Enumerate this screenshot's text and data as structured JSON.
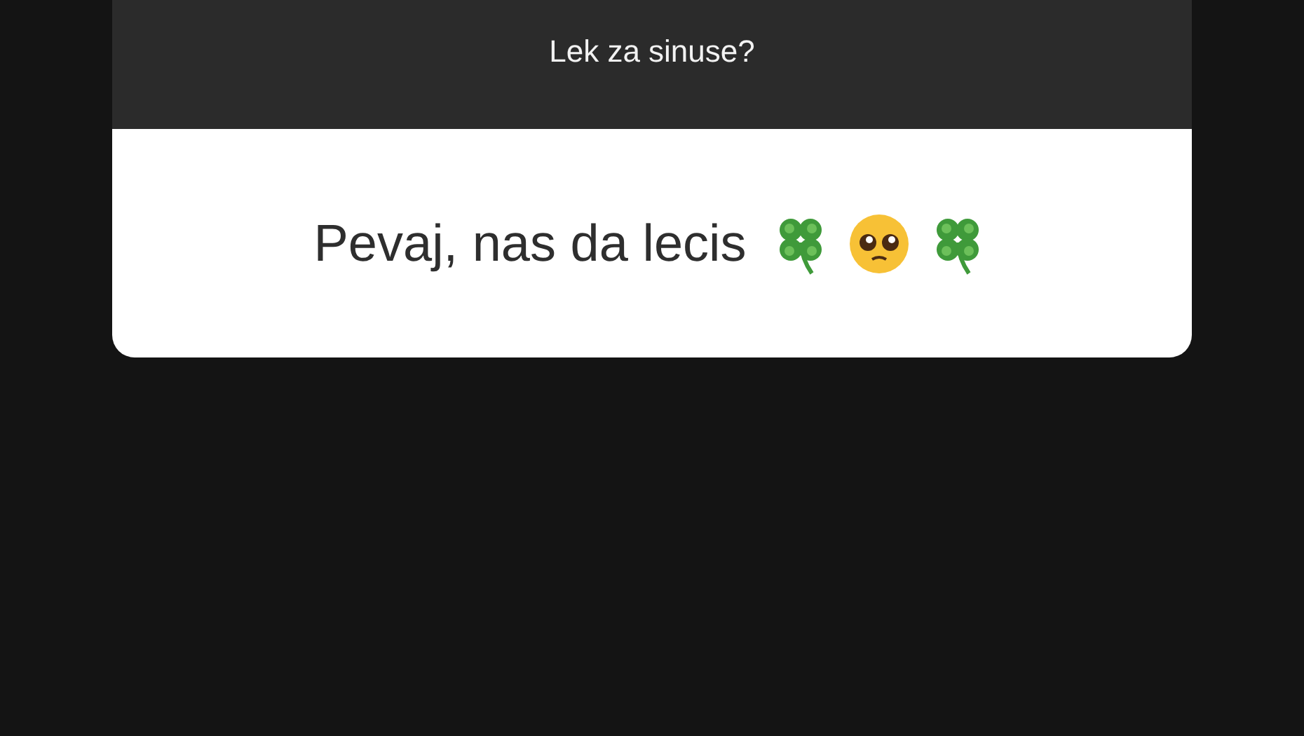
{
  "question": "Lek za sinuse?",
  "answer": "Pevaj, nas da lecis",
  "emojis": [
    {
      "kind": "clover"
    },
    {
      "kind": "face"
    },
    {
      "kind": "clover"
    }
  ]
}
